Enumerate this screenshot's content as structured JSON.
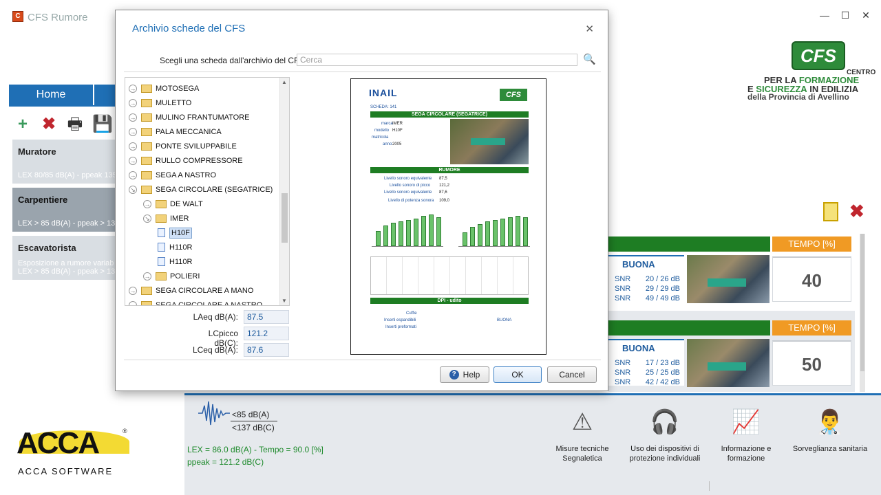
{
  "app": {
    "title": "CFS Rumore",
    "icon": "cfs-app-icon"
  },
  "window_controls": {
    "minimize": "—",
    "maximize": "☐",
    "close": "✕"
  },
  "logo": {
    "badge": "CFS",
    "line1": "CENTRO",
    "line2_a": "PER LA ",
    "line2_b": "FORMAZIONE",
    "line3_a": "E ",
    "line3_b": "SICUREZZA",
    "line3_c": " IN EDILIZIA",
    "line4": "della Provincia di Avellino"
  },
  "tabs": {
    "home": "Home"
  },
  "toolbar": {
    "add": "+",
    "delete": "✖",
    "print": "🖶",
    "save": "💾"
  },
  "jobs": [
    {
      "name": "Muratore",
      "desc": "LEX 80/85 dB(A) - ppeak 135"
    },
    {
      "name": "Carpentiere",
      "desc": "LEX > 85 dB(A) - ppeak > 13"
    },
    {
      "name": "Escavatorista",
      "desc": "Esposizione a rumore variab",
      "desc2": "LEX > 85 dB(A) - ppeak > 13"
    }
  ],
  "cards": [
    {
      "tempo_header": "TEMPO [%]",
      "tempo": "40",
      "rating": "BUONA",
      "snr": [
        {
          "label": "SNR",
          "value": "20 / 26 dB"
        },
        {
          "label": "SNR",
          "value": "29 / 29 dB"
        },
        {
          "label": "SNR",
          "value": "49 / 49 dB"
        }
      ]
    },
    {
      "tempo_header": "TEMPO [%]",
      "tempo": "50",
      "rating": "BUONA",
      "snr": [
        {
          "label": "SNR",
          "value": "17 / 23 dB"
        },
        {
          "label": "SNR",
          "value": "25 / 25 dB"
        },
        {
          "label": "SNR",
          "value": "42 / 42 dB"
        }
      ]
    }
  ],
  "bottom": {
    "thr_a": "<85 dB(A)",
    "thr_b": "<137 dB(C)",
    "lex": "LEX = 86.0 dB(A) - Tempo = 90.0 [%]",
    "ppeak": "ppeak = 121.2 dB(C)",
    "actions": [
      {
        "line1": "Misure tecniche",
        "line2": "Segnaletica",
        "icon": "warning-sign-icon"
      },
      {
        "line1": "Uso dei dispositivi di",
        "line2": "protezione individuali",
        "icon": "ear-protection-icon"
      },
      {
        "line1": "Informazione e",
        "line2": "formazione",
        "icon": "presentation-board-icon"
      },
      {
        "line1": "Sorveglianza sanitaria",
        "line2": "",
        "icon": "doctor-icon"
      }
    ]
  },
  "acca": {
    "logo": "ACCA",
    "reg": "®",
    "sub": "ACCA SOFTWARE"
  },
  "dialog": {
    "title": "Archivio schede del CFS",
    "close": "✕",
    "search_label": "Scegli una scheda dall'archivio del CFS:",
    "search_placeholder": "Cerca",
    "tree": [
      {
        "label": "MOTOSEGA",
        "level": 0,
        "type": "folder",
        "exp": "→"
      },
      {
        "label": "MULETTO",
        "level": 0,
        "type": "folder",
        "exp": "→"
      },
      {
        "label": "MULINO FRANTUMATORE",
        "level": 0,
        "type": "folder",
        "exp": "→"
      },
      {
        "label": "PALA MECCANICA",
        "level": 0,
        "type": "folder",
        "exp": "→"
      },
      {
        "label": "PONTE SVILUPPABILE",
        "level": 0,
        "type": "folder",
        "exp": "→"
      },
      {
        "label": "RULLO COMPRESSORE",
        "level": 0,
        "type": "folder",
        "exp": "→"
      },
      {
        "label": "SEGA A NASTRO",
        "level": 0,
        "type": "folder",
        "exp": "→"
      },
      {
        "label": "SEGA CIRCOLARE (SEGATRICE)",
        "level": 0,
        "type": "folder",
        "exp": "↘"
      },
      {
        "label": "DE WALT",
        "level": 1,
        "type": "folder",
        "exp": "→"
      },
      {
        "label": "IMER",
        "level": 1,
        "type": "folder",
        "exp": "↘"
      },
      {
        "label": "H10F",
        "level": 2,
        "type": "file",
        "selected": true
      },
      {
        "label": "H110R",
        "level": 2,
        "type": "file"
      },
      {
        "label": "H110R",
        "level": 2,
        "type": "file"
      },
      {
        "label": "POLIERI",
        "level": 1,
        "type": "folder",
        "exp": "→"
      },
      {
        "label": "SEGA CIRCOLARE A MANO",
        "level": 0,
        "type": "folder",
        "exp": "→"
      },
      {
        "label": "SEGA CIRCOLARE A NASTRO",
        "level": 0,
        "type": "folder",
        "exp": "→"
      }
    ],
    "fields": [
      {
        "label": "LAeq dB(A):",
        "value": "87.5"
      },
      {
        "label": "LCpicco dB(C):",
        "value": "121.2"
      },
      {
        "label": "LCeq dB(A):",
        "value": "87.6"
      }
    ],
    "preview": {
      "inail": "INAIL",
      "cfs": "CFS",
      "scheda": "SCHEDA: 141",
      "title": "SEGA CIRCOLARE (SEGATRICE)",
      "marca_label": "marca",
      "marca": "IMER",
      "modello_label": "modello",
      "modello": "H10F",
      "matricola_label": "matricola",
      "anno_label": "anno",
      "anno": "2005",
      "rumore": "RUMORE",
      "l1": "Livello sonoro equivalente",
      "v1": "87,5",
      "l2": "Livello sonoro di picco",
      "v2": "121,2",
      "l3": "Livello sonoro equivalente",
      "v3": "87,6",
      "l4": "Livello di potenza sonora",
      "v4": "109,0",
      "dpi": "DPI - udito",
      "cuffie": "Cuffie",
      "inserti1": "Inserti espandibili",
      "inserti2": "Inserti preformati",
      "buona": "BUONA"
    },
    "buttons": {
      "help": "Help",
      "ok": "OK",
      "cancel": "Cancel"
    }
  }
}
